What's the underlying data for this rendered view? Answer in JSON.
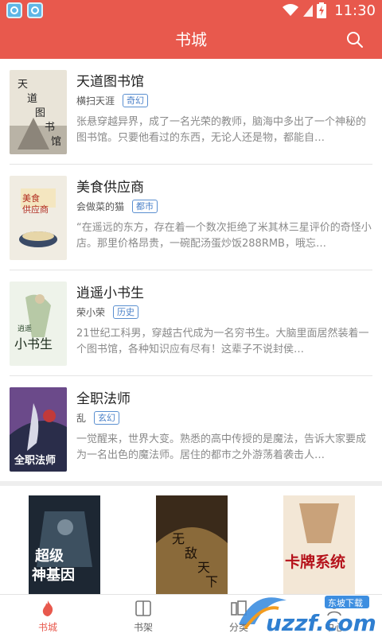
{
  "status_bar": {
    "time": "11:30",
    "battery_icon": "battery-charging-icon",
    "wifi_icon": "wifi-icon",
    "signal_icon": "signal-icon"
  },
  "header": {
    "title": "书城",
    "search_icon": "search-icon"
  },
  "books": [
    {
      "title": "天道图书馆",
      "author": "横扫天涯",
      "genre": "奇幻",
      "description": "张悬穿越异界，成了一名光荣的教师，脑海中多出了一个神秘的图书馆。只要他看过的东西，无论人还是物，都能自…",
      "cover_text": "天道图书馆"
    },
    {
      "title": "美食供应商",
      "author": "会做菜的猫",
      "genre": "都市",
      "description": "“在遥远的东方，存在着一个数次拒绝了米其林三星评价的奇怪小店。那里价格昂贵，一碗配汤蛋炒饭288RMB，哦忘…",
      "cover_text": "美食供应商"
    },
    {
      "title": "逍遥小书生",
      "author": "荣小荣",
      "genre": "历史",
      "description": "21世纪工科男，穿越古代成为一名穷书生。大脑里面居然装着一个图书馆，各种知识应有尽有！这辈子不说封侯…",
      "cover_text": "逍遥小书生"
    },
    {
      "title": "全职法师",
      "author": "乱",
      "genre": "玄幻",
      "description": "一觉醒来，世界大变。熟悉的高中传授的是魔法，告诉大家要成为一名出色的魔法师。居住的都市之外游荡着袭击人…",
      "cover_text": "全职法师"
    }
  ],
  "featured": [
    {
      "cover_text": "超级神基因"
    },
    {
      "cover_text": "无敌天下"
    },
    {
      "cover_text": "卡牌系统"
    }
  ],
  "tabs": [
    {
      "label": "书城",
      "icon": "flame-icon",
      "active": true
    },
    {
      "label": "书架",
      "icon": "book-shelf-icon",
      "active": false
    },
    {
      "label": "分类",
      "icon": "category-icon",
      "active": false
    },
    {
      "label": "中心",
      "icon": "user-center-icon",
      "active": false
    }
  ],
  "watermark": {
    "text": "uzzf.com",
    "subtext": "东坡下载"
  },
  "colors": {
    "accent": "#e8594d",
    "tag": "#4a80c8"
  }
}
